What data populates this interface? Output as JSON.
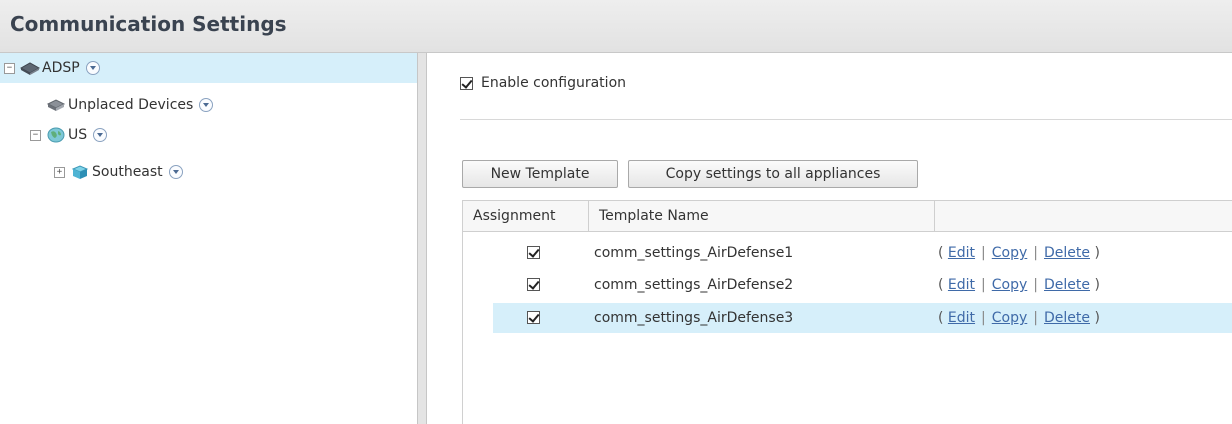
{
  "window": {
    "title": "Communication Settings"
  },
  "tree": {
    "nodes": [
      {
        "label": "ADSP",
        "expander": "−",
        "icon": "server-icon",
        "selected": true
      },
      {
        "label": "Unplaced Devices",
        "expander": "",
        "icon": "devices-icon",
        "selected": false
      },
      {
        "label": "US",
        "expander": "−",
        "icon": "globe-icon",
        "selected": false
      },
      {
        "label": "Southeast",
        "expander": "+",
        "icon": "region-icon",
        "selected": false
      }
    ]
  },
  "main": {
    "enable_label": "Enable configuration",
    "enable_checked": true,
    "new_template_label": "New Template",
    "copy_settings_label": "Copy settings to all appliances"
  },
  "grid": {
    "columns": [
      "Assignment",
      "Template Name",
      ""
    ],
    "rows": [
      {
        "assigned": true,
        "name": "comm_settings_AirDefense1",
        "edit": "Edit",
        "copy": "Copy",
        "delete": "Delete",
        "selected": false
      },
      {
        "assigned": true,
        "name": "comm_settings_AirDefense2",
        "edit": "Edit",
        "copy": "Copy",
        "delete": "Delete",
        "selected": false
      },
      {
        "assigned": true,
        "name": "comm_settings_AirDefense3",
        "edit": "Edit",
        "copy": "Copy",
        "delete": "Delete",
        "selected": true
      }
    ],
    "paren_open": "(",
    "paren_close": ")",
    "separator": "|"
  },
  "colors": {
    "selection": "#d6effa",
    "link": "#3f6aa8",
    "title": "#3a4350"
  }
}
